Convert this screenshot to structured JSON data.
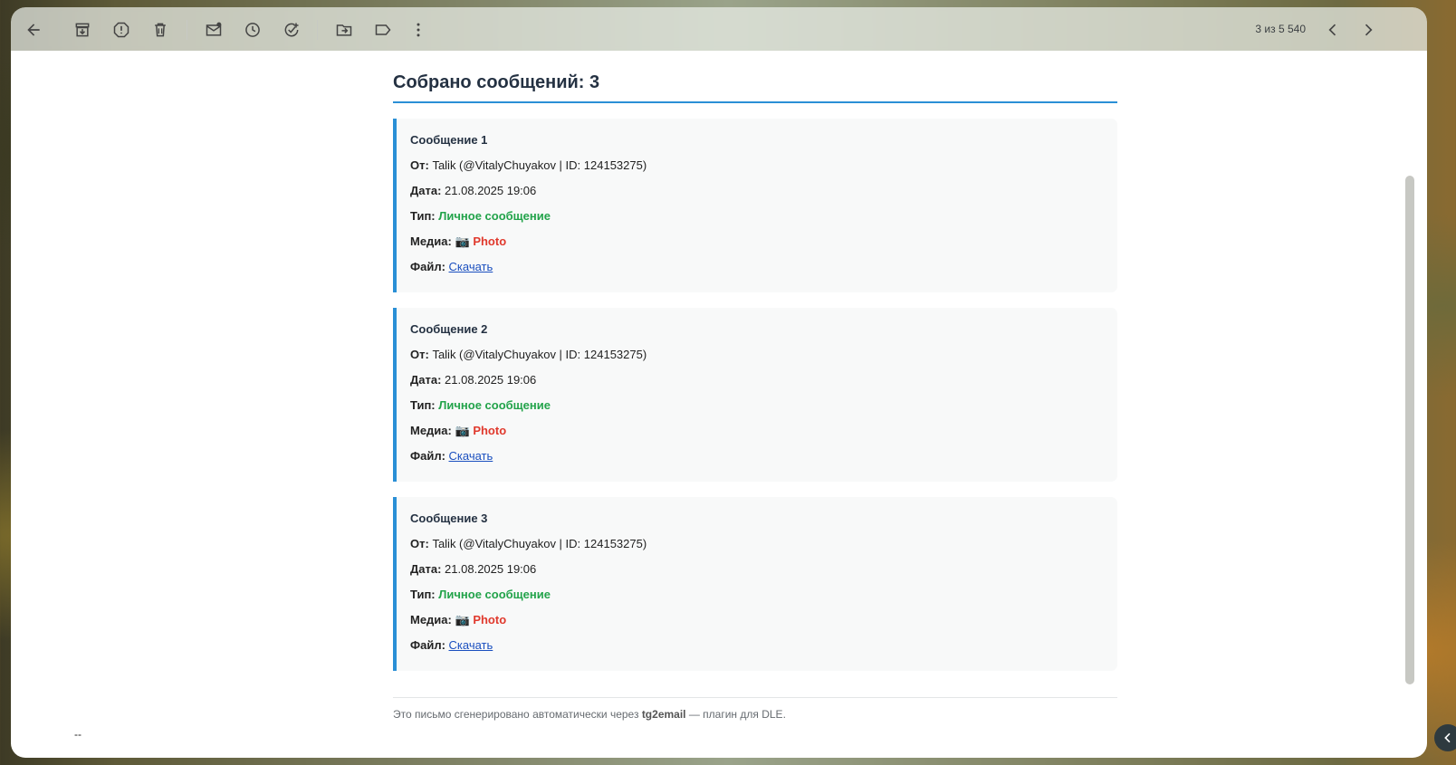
{
  "toolbar": {
    "counter": "3 из 5 540",
    "icons": [
      "back-arrow-icon",
      "archive-icon",
      "report-spam-icon",
      "delete-icon",
      "mark-unread-icon",
      "snooze-icon",
      "add-task-icon",
      "move-to-icon",
      "label-icon",
      "more-vert-icon",
      "chevron-left-icon",
      "chevron-right-icon"
    ]
  },
  "email": {
    "heading": "Собрано сообщений: 3",
    "messages": [
      {
        "title": "Сообщение 1",
        "from_label": "От:",
        "from_value": "Talik (@VitalyChuyakov | ID: 124153275)",
        "date_label": "Дата:",
        "date_value": "21.08.2025 19:06",
        "type_label": "Тип:",
        "type_value": "Личное сообщение",
        "media_label": "Медиа:",
        "media_emoji": "📷",
        "media_value": "Photo",
        "file_label": "Файл:",
        "file_link": "Скачать"
      },
      {
        "title": "Сообщение 2",
        "from_label": "От:",
        "from_value": "Talik (@VitalyChuyakov | ID: 124153275)",
        "date_label": "Дата:",
        "date_value": "21.08.2025 19:06",
        "type_label": "Тип:",
        "type_value": "Личное сообщение",
        "media_label": "Медиа:",
        "media_emoji": "📷",
        "media_value": "Photo",
        "file_label": "Файл:",
        "file_link": "Скачать"
      },
      {
        "title": "Сообщение 3",
        "from_label": "От:",
        "from_value": "Talik (@VitalyChuyakov | ID: 124153275)",
        "date_label": "Дата:",
        "date_value": "21.08.2025 19:06",
        "type_label": "Тип:",
        "type_value": "Личное сообщение",
        "media_label": "Медиа:",
        "media_emoji": "📷",
        "media_value": "Photo",
        "file_label": "Файл:",
        "file_link": "Скачать"
      }
    ],
    "footer_prefix": "Это письмо сгенерировано автоматически через ",
    "footer_brand": "tg2email",
    "footer_suffix": " — плагин для DLE.",
    "signature_dash": "--"
  },
  "colors": {
    "accent": "#2a8fd6",
    "type_green": "#22a34a",
    "media_red": "#e0392d",
    "link_blue": "#1a4fbf"
  }
}
